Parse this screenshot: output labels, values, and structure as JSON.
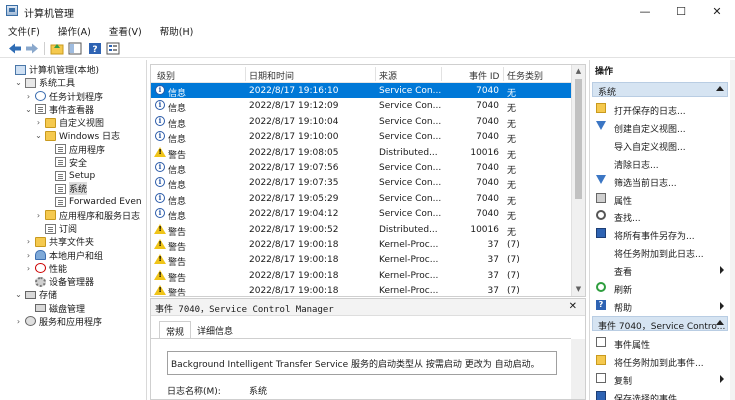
{
  "window": {
    "title": "计算机管理",
    "minimize": "—",
    "maximize": "☐",
    "close": "✕"
  },
  "menu": [
    "文件(F)",
    "操作(A)",
    "查看(V)",
    "帮助(H)"
  ],
  "tree": [
    {
      "label": "计算机管理(本地)",
      "twisty": "",
      "icon": "comp",
      "indent": 0
    },
    {
      "label": "系统工具",
      "twisty": "v",
      "icon": "sys",
      "indent": 1
    },
    {
      "label": "任务计划程序",
      "twisty": ">",
      "icon": "clock",
      "indent": 2
    },
    {
      "label": "事件查看器",
      "twisty": "v",
      "icon": "doc",
      "indent": 2
    },
    {
      "label": "自定义视图",
      "twisty": ">",
      "icon": "folder",
      "indent": 3
    },
    {
      "label": "Windows 日志",
      "twisty": "v",
      "icon": "folder",
      "indent": 3
    },
    {
      "label": "应用程序",
      "twisty": "",
      "icon": "doc",
      "indent": 4
    },
    {
      "label": "安全",
      "twisty": "",
      "icon": "doc",
      "indent": 4
    },
    {
      "label": "Setup",
      "twisty": "",
      "icon": "doc",
      "indent": 4
    },
    {
      "label": "系统",
      "twisty": "",
      "icon": "doc",
      "indent": 4,
      "selected": true
    },
    {
      "label": "Forwarded Even",
      "twisty": "",
      "icon": "doc",
      "indent": 4
    },
    {
      "label": "应用程序和服务日志",
      "twisty": ">",
      "icon": "folder",
      "indent": 3
    },
    {
      "label": "订阅",
      "twisty": "",
      "icon": "doc",
      "indent": 3
    },
    {
      "label": "共享文件夹",
      "twisty": ">",
      "icon": "folder",
      "indent": 2
    },
    {
      "label": "本地用户和组",
      "twisty": ">",
      "icon": "users",
      "indent": 2
    },
    {
      "label": "性能",
      "twisty": ">",
      "icon": "perf",
      "indent": 2
    },
    {
      "label": "设备管理器",
      "twisty": "",
      "icon": "gear",
      "indent": 2
    },
    {
      "label": "存储",
      "twisty": "v",
      "icon": "disk",
      "indent": 1
    },
    {
      "label": "磁盘管理",
      "twisty": "",
      "icon": "disk",
      "indent": 2
    },
    {
      "label": "服务和应用程序",
      "twisty": ">",
      "icon": "svc",
      "indent": 1
    }
  ],
  "list": {
    "headers": [
      "级别",
      "日期和时间",
      "来源",
      "事件 ID",
      "任务类别"
    ],
    "rows": [
      {
        "level": "信息",
        "type": "info",
        "datetime": "2022/8/17 19:16:10",
        "source": "Service Con...",
        "id": "7040",
        "category": "无",
        "selected": true
      },
      {
        "level": "信息",
        "type": "info",
        "datetime": "2022/8/17 19:12:09",
        "source": "Service Con...",
        "id": "7040",
        "category": "无"
      },
      {
        "level": "信息",
        "type": "info",
        "datetime": "2022/8/17 19:10:04",
        "source": "Service Con...",
        "id": "7040",
        "category": "无"
      },
      {
        "level": "信息",
        "type": "info",
        "datetime": "2022/8/17 19:10:00",
        "source": "Service Con...",
        "id": "7040",
        "category": "无"
      },
      {
        "level": "警告",
        "type": "warn",
        "datetime": "2022/8/17 19:08:05",
        "source": "Distributed...",
        "id": "10016",
        "category": "无"
      },
      {
        "level": "信息",
        "type": "info",
        "datetime": "2022/8/17 19:07:56",
        "source": "Service Con...",
        "id": "7040",
        "category": "无"
      },
      {
        "level": "信息",
        "type": "info",
        "datetime": "2022/8/17 19:07:35",
        "source": "Service Con...",
        "id": "7040",
        "category": "无"
      },
      {
        "level": "信息",
        "type": "info",
        "datetime": "2022/8/17 19:05:29",
        "source": "Service Con...",
        "id": "7040",
        "category": "无"
      },
      {
        "level": "信息",
        "type": "info",
        "datetime": "2022/8/17 19:04:12",
        "source": "Service Con...",
        "id": "7040",
        "category": "无"
      },
      {
        "level": "警告",
        "type": "warn",
        "datetime": "2022/8/17 19:00:52",
        "source": "Distributed...",
        "id": "10016",
        "category": "无"
      },
      {
        "level": "警告",
        "type": "warn",
        "datetime": "2022/8/17 19:00:18",
        "source": "Kernel-Proc...",
        "id": "37",
        "category": "(7)"
      },
      {
        "level": "警告",
        "type": "warn",
        "datetime": "2022/8/17 19:00:18",
        "source": "Kernel-Proc...",
        "id": "37",
        "category": "(7)"
      },
      {
        "level": "警告",
        "type": "warn",
        "datetime": "2022/8/17 19:00:18",
        "source": "Kernel-Proc...",
        "id": "37",
        "category": "(7)"
      },
      {
        "level": "警告",
        "type": "warn",
        "datetime": "2022/8/17 19:00:18",
        "source": "Kernel-Proc...",
        "id": "37",
        "category": "(7)"
      }
    ]
  },
  "detail": {
    "title": "事件 7040，Service Control Manager",
    "close": "✕",
    "tabs": [
      "常规",
      "详细信息"
    ],
    "description": "Background Intelligent Transfer Service 服务的启动类型从 按需启动 更改为 自动启动。",
    "log_name_label": "日志名称(M):",
    "log_name_value": "系统"
  },
  "actions": {
    "header": "操作",
    "section1": "系统",
    "items1": [
      {
        "label": "打开保存的日志...",
        "icon": "open"
      },
      {
        "label": "创建自定义视图...",
        "icon": "filter"
      },
      {
        "label": "导入自定义视图...",
        "icon": ""
      },
      {
        "label": "清除日志...",
        "icon": ""
      },
      {
        "label": "筛选当前日志...",
        "icon": "filter"
      },
      {
        "label": "属性",
        "icon": "props"
      },
      {
        "label": "查找...",
        "icon": "find"
      },
      {
        "label": "将所有事件另存为...",
        "icon": "save"
      },
      {
        "label": "将任务附加到此日志...",
        "icon": ""
      },
      {
        "label": "查看",
        "icon": "",
        "submenu": true
      },
      {
        "label": "刷新",
        "icon": "refresh"
      },
      {
        "label": "帮助",
        "icon": "help",
        "submenu": true
      }
    ],
    "section2": "事件 7040，Service Contro...",
    "items2": [
      {
        "label": "事件属性",
        "icon": "event"
      },
      {
        "label": "将任务附加到此事件...",
        "icon": "attach"
      },
      {
        "label": "复制",
        "icon": "copy",
        "submenu": true
      },
      {
        "label": "保存选择的事件...",
        "icon": "save"
      }
    ]
  }
}
